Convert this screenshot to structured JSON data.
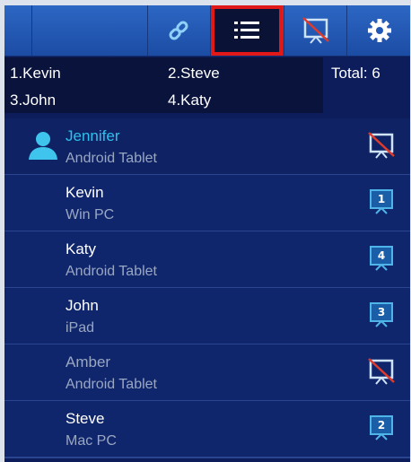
{
  "toolbar": {
    "buttons": [
      {
        "icon": "link-icon"
      },
      {
        "icon": "list-icon",
        "active": true
      },
      {
        "icon": "screen-off-icon"
      },
      {
        "icon": "gear-icon"
      }
    ]
  },
  "presenter_list": {
    "items": [
      "1.Kevin",
      "2.Steve",
      "3.John",
      "4.Katy"
    ],
    "total_label": "Total: 6"
  },
  "users": [
    {
      "name": "Jennifer",
      "device": "Android Tablet",
      "slot": "",
      "status": "not-presenting",
      "host": true
    },
    {
      "name": "Kevin",
      "device": "Win PC",
      "slot": "1",
      "status": "presenting"
    },
    {
      "name": "Katy",
      "device": "Android Tablet",
      "slot": "4",
      "status": "presenting"
    },
    {
      "name": "John",
      "device": "iPad",
      "slot": "3",
      "status": "presenting"
    },
    {
      "name": "Amber",
      "device": "Android Tablet",
      "slot": "",
      "status": "not-presenting"
    },
    {
      "name": "Steve",
      "device": "Mac PC",
      "slot": "2",
      "status": "presenting"
    }
  ],
  "colors": {
    "toolbar": "#2c67c4",
    "background": "#0d1d5c",
    "highlight": "#e01818",
    "host_name": "#2ec0ee",
    "slot_icon": "#4fb4e8",
    "not_presenting_slash": "#e03a2a"
  }
}
